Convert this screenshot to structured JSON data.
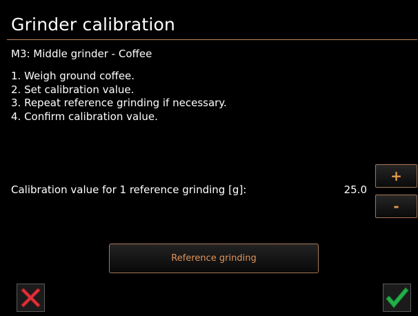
{
  "header": {
    "title": "Grinder calibration"
  },
  "subtitle": "M3: Middle grinder - Coffee",
  "steps": [
    "1. Weigh ground coffee.",
    "2. Set calibration value.",
    "3. Repeat reference grinding if necessary.",
    "4. Confirm calibration value."
  ],
  "calibration": {
    "label": "Calibration value for 1 reference grinding [g]:",
    "value": "25.0",
    "increment_label": "+",
    "decrement_label": "-"
  },
  "reference_button": {
    "label": "Reference grinding"
  },
  "footer": {
    "cancel_icon": "red-x-icon",
    "confirm_icon": "green-checkmark-icon"
  },
  "colors": {
    "accent": "#e0955c",
    "border": "#a87a57",
    "cancel": "#e0323a",
    "confirm": "#22b04a"
  }
}
